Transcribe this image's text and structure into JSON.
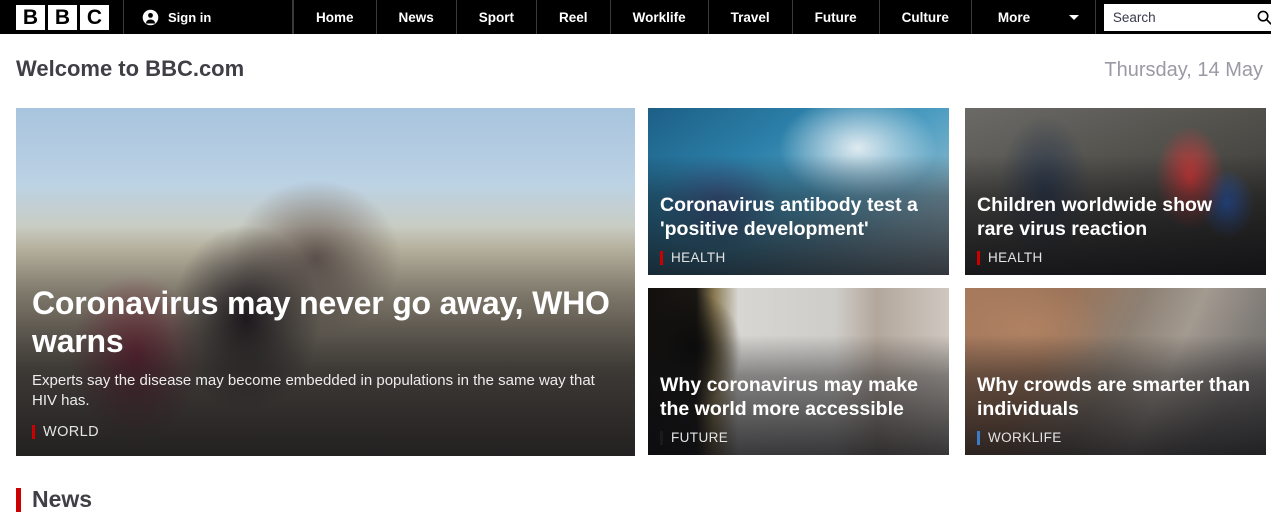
{
  "nav": {
    "logo_letters": [
      "B",
      "B",
      "C"
    ],
    "signin": {
      "icon": "avatar-icon",
      "label": "Sign in"
    },
    "items": [
      {
        "label": "Home"
      },
      {
        "label": "News"
      },
      {
        "label": "Sport"
      },
      {
        "label": "Reel"
      },
      {
        "label": "Worklife"
      },
      {
        "label": "Travel"
      },
      {
        "label": "Future"
      },
      {
        "label": "Culture"
      }
    ],
    "more": {
      "label": "More",
      "icon": "chevron-down-icon"
    },
    "search": {
      "placeholder": "Search",
      "value": "",
      "icon": "search-icon"
    }
  },
  "welcome": {
    "title": "Welcome to BBC.com",
    "date": "Thursday, 14 May"
  },
  "hero": {
    "headline": "Coronavirus may never go away, WHO warns",
    "summary": "Experts say the disease may become embedded in populations in the same way that HIV has.",
    "tag": "WORLD",
    "tag_color": "#cc0000"
  },
  "cards": [
    {
      "headline": "Coronavirus antibody test a 'positive development'",
      "tag": "HEALTH",
      "tag_color": "#cc0000"
    },
    {
      "headline": "Children worldwide show rare virus reaction",
      "tag": "HEALTH",
      "tag_color": "#cc0000"
    },
    {
      "headline": "Why coronavirus may make the world more accessible",
      "tag": "FUTURE",
      "tag_color": "#1a1a1a"
    },
    {
      "headline": "Why crowds are smarter than individuals",
      "tag": "WORKLIFE",
      "tag_color": "#3b7cc4"
    }
  ],
  "news_section": {
    "title": "News",
    "bar_color": "#cc0000"
  }
}
